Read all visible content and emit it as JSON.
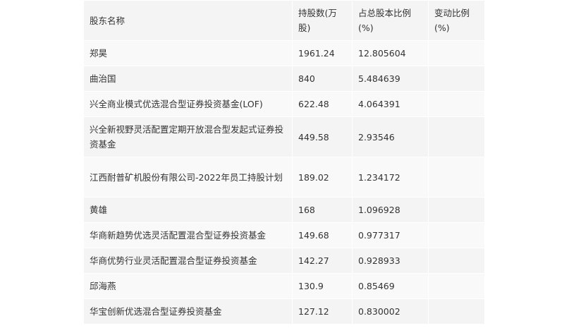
{
  "table": {
    "headers": [
      "股东名称",
      "持股数(万股)",
      "占总股本比例(%)",
      "变动比例(%)"
    ],
    "rows": [
      [
        "郑昊",
        "1961.24",
        "12.805604",
        ""
      ],
      [
        "曲治国",
        "840",
        "5.484639",
        ""
      ],
      [
        "兴全商业模式优选混合型证券投资基金(LOF)",
        "622.48",
        "4.064391",
        ""
      ],
      [
        "兴全新视野灵活配置定期开放混合型发起式证券投资基金",
        "449.58",
        "2.93546",
        ""
      ],
      [
        "江西耐普矿机股份有限公司-2022年员工持股计划",
        "189.02",
        "1.234172",
        ""
      ],
      [
        "黄雄",
        "168",
        "1.096928",
        ""
      ],
      [
        "华商新趋势优选灵活配置混合型证券投资基金",
        "149.68",
        "0.977317",
        ""
      ],
      [
        "华商优势行业灵活配置混合型证券投资基金",
        "142.27",
        "0.928933",
        ""
      ],
      [
        "邱海燕",
        "130.9",
        "0.85469",
        ""
      ],
      [
        "华宝创新优选混合型证券投资基金",
        "127.12",
        "0.830002",
        ""
      ]
    ]
  }
}
